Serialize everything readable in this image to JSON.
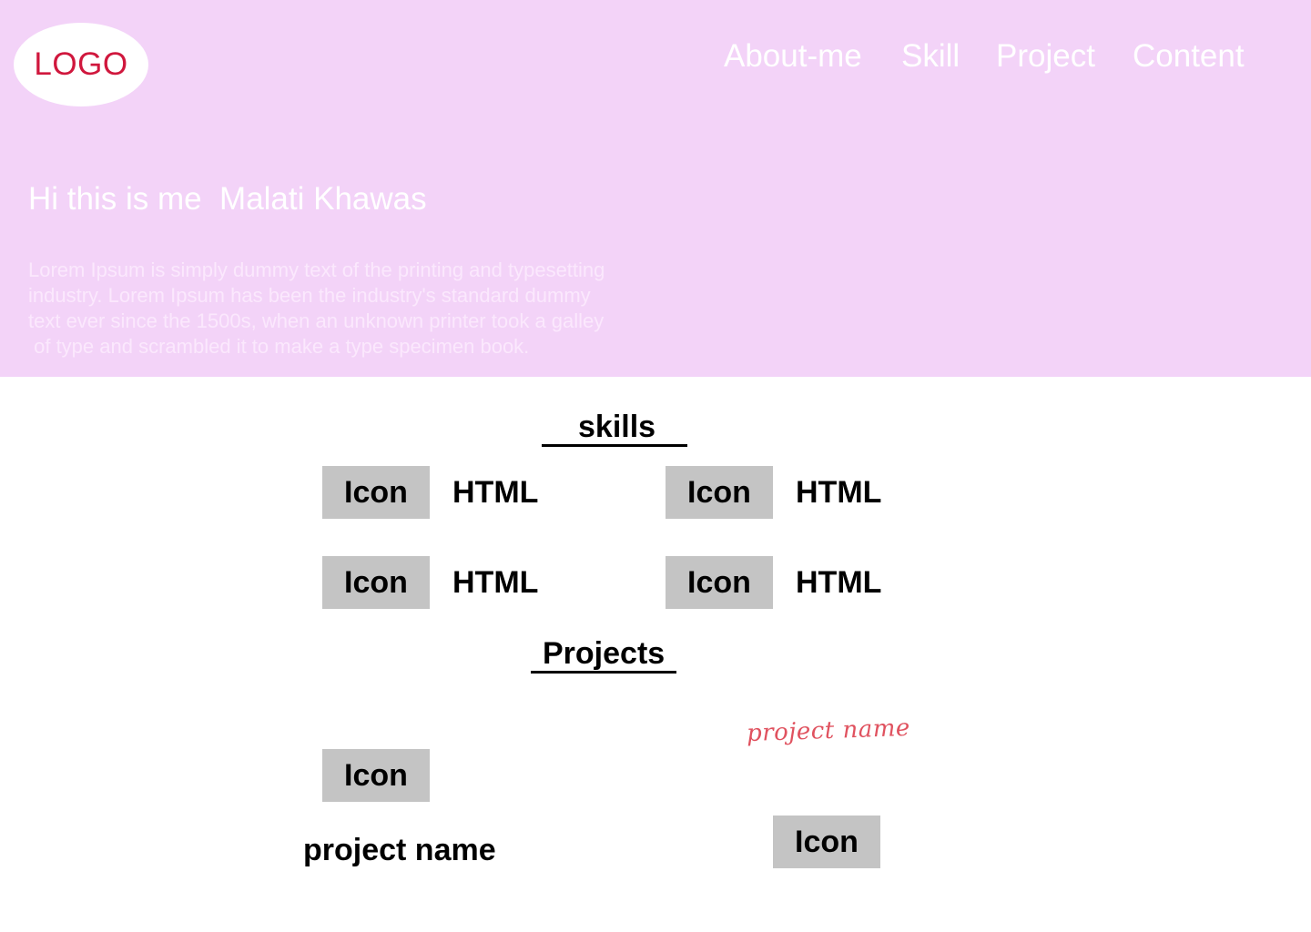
{
  "logo": {
    "label": "LOGO"
  },
  "nav": {
    "items": [
      {
        "label": "About-me"
      },
      {
        "label": "Skill"
      },
      {
        "label": "Project"
      },
      {
        "label": "Content"
      }
    ]
  },
  "hero": {
    "title": "Hi this is me  Malati Khawas",
    "text": "Lorem Ipsum is simply dummy text of the printing and typesetting\nindustry. Lorem Ipsum has been the industry's standard dummy\ntext ever since the 1500s, when an unknown printer took a galley\n of type and scrambled it to make a type specimen book."
  },
  "skills": {
    "heading": "skills",
    "items": [
      {
        "icon_label": "Icon",
        "label": "HTML"
      },
      {
        "icon_label": "Icon",
        "label": "HTML"
      },
      {
        "icon_label": "Icon",
        "label": "HTML"
      },
      {
        "icon_label": "Icon",
        "label": "HTML"
      }
    ]
  },
  "projects": {
    "heading": "Projects",
    "items": [
      {
        "icon_label": "Icon",
        "name": "project name"
      },
      {
        "icon_label": "Icon",
        "name": "project name"
      }
    ]
  },
  "colors": {
    "hero_background": "#f3d3f8",
    "logo_text": "#d0173d",
    "icon_placeholder": "#c4c4c4",
    "script_name": "#e0525f"
  }
}
